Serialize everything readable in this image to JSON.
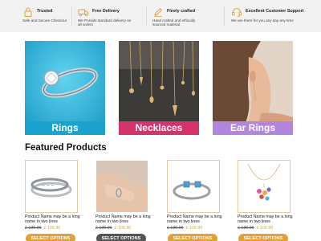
{
  "features": [
    {
      "icon": "lock-icon",
      "title": "Trusted",
      "description": [
        "Safe and Secure Checkout"
      ]
    },
    {
      "icon": "truck-icon",
      "title": "Free Delivery",
      "description": [
        "We Provide standard delivery on",
        "all orders"
      ]
    },
    {
      "icon": "pencil-icon",
      "title": "Finely crafted",
      "description": [
        "Hand crafted and ethically",
        "sourced material"
      ]
    },
    {
      "icon": "headset-icon",
      "title": "Excellent Customer Support",
      "description": [
        "We are there for you any day any time"
      ]
    }
  ],
  "categories": [
    {
      "label": "Rings",
      "color": "#1aa3cf"
    },
    {
      "label": "Necklaces",
      "color": "#d4336d"
    },
    {
      "label": "Ear Rings",
      "color": "#b186dc"
    }
  ],
  "featured": {
    "title": "Featured Products",
    "products": [
      {
        "name": [
          "Product Name may be a long",
          "name in two lines"
        ],
        "old_price": "£ 139.90",
        "new_price": "£ 109.90",
        "button": "SELECT OPTIONS"
      },
      {
        "name": [
          "Product Name may be a long",
          "name in two lines"
        ],
        "old_price": "£ 139.90",
        "new_price": "£ 109.90",
        "button": "SELECT OPTIONS"
      },
      {
        "name": [
          "Product Name may be a long",
          "name in two lines"
        ],
        "old_price": "£ 139.90",
        "new_price": "£ 109.90",
        "button": "SELECT OPTIONS"
      },
      {
        "name": [
          "Product Name may be a long",
          "name in two lines"
        ],
        "old_price": "£ 139.90",
        "new_price": "£ 109.90",
        "button": "SELECT OPTIONS"
      }
    ]
  },
  "colors": {
    "accent": "#e0a13c",
    "feature_bg": "#f2f2f2",
    "dark_button": "#555555"
  }
}
